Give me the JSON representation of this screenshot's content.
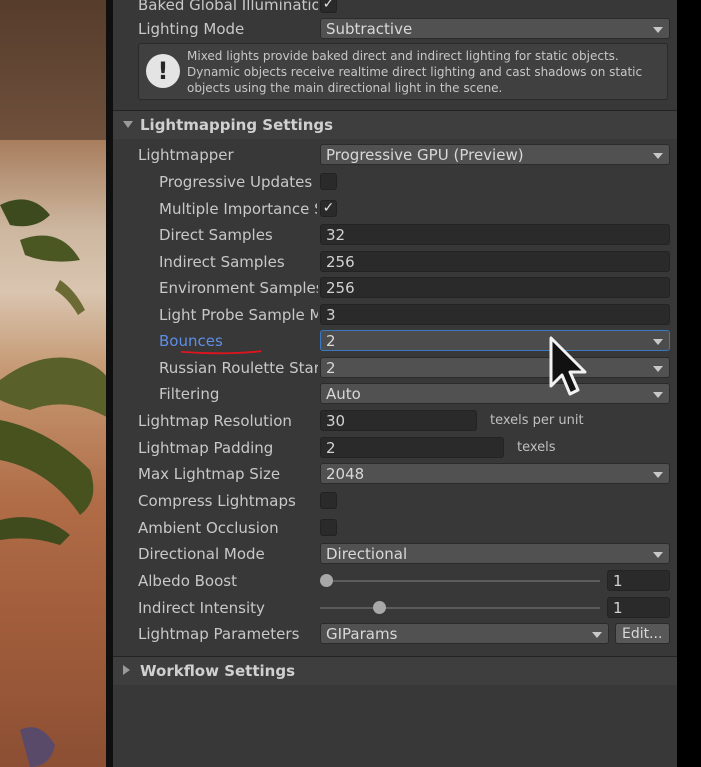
{
  "lighting": {
    "baked_gi_label": "Baked Global Illuminatio",
    "baked_gi_checked": "✓",
    "mode_label": "Lighting Mode",
    "mode_value": "Subtractive",
    "help_text": "Mixed lights provide baked direct and indirect lighting for static objects. Dynamic objects receive realtime direct lighting and cast shadows on static objects using the main directional light in the scene.",
    "help_icon": "!"
  },
  "lightmapping": {
    "section_title": "Lightmapping Settings",
    "lightmapper_label": "Lightmapper",
    "lightmapper_value": "Progressive GPU (Preview)",
    "progressive_updates_label": "Progressive Updates",
    "progressive_updates_checked": "",
    "mis_label": "Multiple Importance S",
    "mis_checked": "✓",
    "direct_samples_label": "Direct Samples",
    "direct_samples_value": "32",
    "indirect_samples_label": "Indirect Samples",
    "indirect_samples_value": "256",
    "environment_samples_label": "Environment Samples",
    "environment_samples_value": "256",
    "light_probe_label": "Light Probe Sample M",
    "light_probe_value": "3",
    "bounces_label": "Bounces",
    "bounces_value": "2",
    "russian_roulette_label": "Russian Roulette Star",
    "russian_roulette_value": "2",
    "filtering_label": "Filtering",
    "filtering_value": "Auto",
    "resolution_label": "Lightmap Resolution",
    "resolution_value": "30",
    "resolution_unit": "texels per unit",
    "padding_label": "Lightmap Padding",
    "padding_value": "2",
    "padding_unit": "texels",
    "max_size_label": "Max Lightmap Size",
    "max_size_value": "2048",
    "compress_label": "Compress Lightmaps",
    "compress_checked": "",
    "ao_label": "Ambient Occlusion",
    "ao_checked": "",
    "directional_mode_label": "Directional Mode",
    "directional_mode_value": "Directional",
    "albedo_boost_label": "Albedo Boost",
    "albedo_boost_value": "1",
    "albedo_boost_fraction": 0.0,
    "indirect_intensity_label": "Indirect Intensity",
    "indirect_intensity_value": "1",
    "indirect_intensity_fraction": 0.2,
    "parameters_label": "Lightmap Parameters",
    "parameters_value": "GIParams",
    "edit_button": "Edit..."
  },
  "workflow": {
    "section_title": "Workflow Settings"
  },
  "colors": {
    "panel_bg": "#383838",
    "field_bg": "#2a2a2a",
    "focus_border": "#3a78c2",
    "bounces_highlight": "#5f8ee6",
    "annotation_red": "#e0141e"
  },
  "icons": [
    "checkmark-icon",
    "info-icon",
    "dropdown-caret-icon",
    "foldout-arrow-icon",
    "mouse-cursor-icon"
  ]
}
